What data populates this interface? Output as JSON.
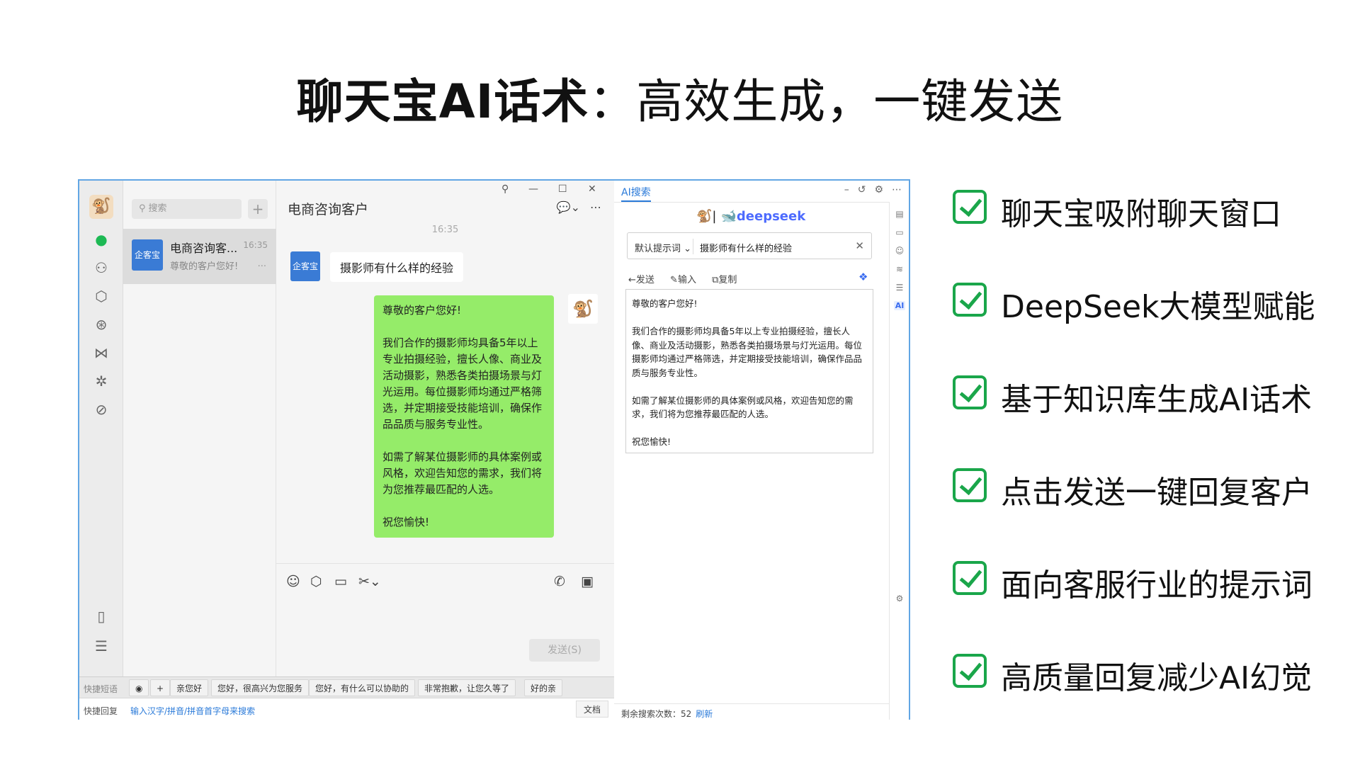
{
  "title": {
    "bold": "聊天宝AI话术",
    "rest": "：高效生成，一键发送"
  },
  "chat_app": {
    "nav": {
      "logo_icon": "monkey-logo",
      "icons": [
        "chat-bubble-icon",
        "contacts-icon",
        "cube-icon",
        "aperture-icon",
        "butterfly-icon",
        "sparkle-icon",
        "link-icon",
        "phone-icon",
        "menu-icon"
      ]
    },
    "search_placeholder": "搜索",
    "add_label": "+",
    "conversation": {
      "avatar_text": "企客宝",
      "name": "电商咨询客...",
      "time": "16:35",
      "preview": "尊敬的客户您好!",
      "more": "..."
    },
    "header": {
      "title": "电商咨询客户",
      "pin": "⚲",
      "minimize": "—",
      "maximize": "☐",
      "close": "✕"
    },
    "messages": {
      "time": "16:35",
      "incoming_avatar": "企客宝",
      "incoming": "摄影师有什么样的经验",
      "outgoing": "尊敬的客户您好!\n\n我们合作的摄影师均具备5年以上专业拍摄经验，擅长人像、商业及活动摄影，熟悉各类拍摄场景与灯光运用。每位摄影师均通过严格筛选，并定期接受技能培训，确保作品品质与服务专业性。\n\n如需了解某位摄影师的具体案例或风格，欢迎告知您的需求，我们将为您推荐最匹配的人选。\n\n祝您愉快!"
    },
    "send_label": "发送(S)",
    "quick_phrases": {
      "label": "快捷短语",
      "chips": [
        "亲您好",
        "您好，很高兴为您服务",
        "您好，有什么可以协助的",
        "非常抱歉，让您久等了",
        "好的亲"
      ]
    },
    "quick_reply": {
      "label": "快捷回复",
      "hint": "输入汉字/拼音/拼音首字母来搜索",
      "doc": "文档"
    }
  },
  "ai_panel": {
    "tab": "AI搜索",
    "brand": "deepseek",
    "prompt_select": "默认提示词",
    "query": "摄影师有什么样的经验",
    "actions": [
      "←发送",
      "✎输入",
      "⧉复制"
    ],
    "result": "尊敬的客户您好!\n\n我们合作的摄影师均具备5年以上专业拍摄经验，擅长人像、商业及活动摄影，熟悉各类拍摄场景与灯光运用。每位摄影师均通过严格筛选，并定期接受技能培训，确保作品品质与服务专业性。\n\n如需了解某位摄影师的具体案例或风格，欢迎告知您的需求，我们将为您推荐最匹配的人选。\n\n祝您愉快!",
    "side_ai_label": "AI",
    "footer_label": "剩余搜索次数：52",
    "footer_refresh": "刷新"
  },
  "features": [
    "聊天宝吸附聊天窗口",
    "DeepSeek大模型赋能",
    "基于知识库生成AI话术",
    "点击发送一键回复客户",
    "面向客服行业的提示词",
    "高质量回复减少AI幻觉"
  ],
  "colors": {
    "accent_green": "#1aa64a",
    "bubble_green": "#95ec69",
    "frame_blue": "#62a6e4",
    "deepseek_blue": "#4d6bfe"
  }
}
